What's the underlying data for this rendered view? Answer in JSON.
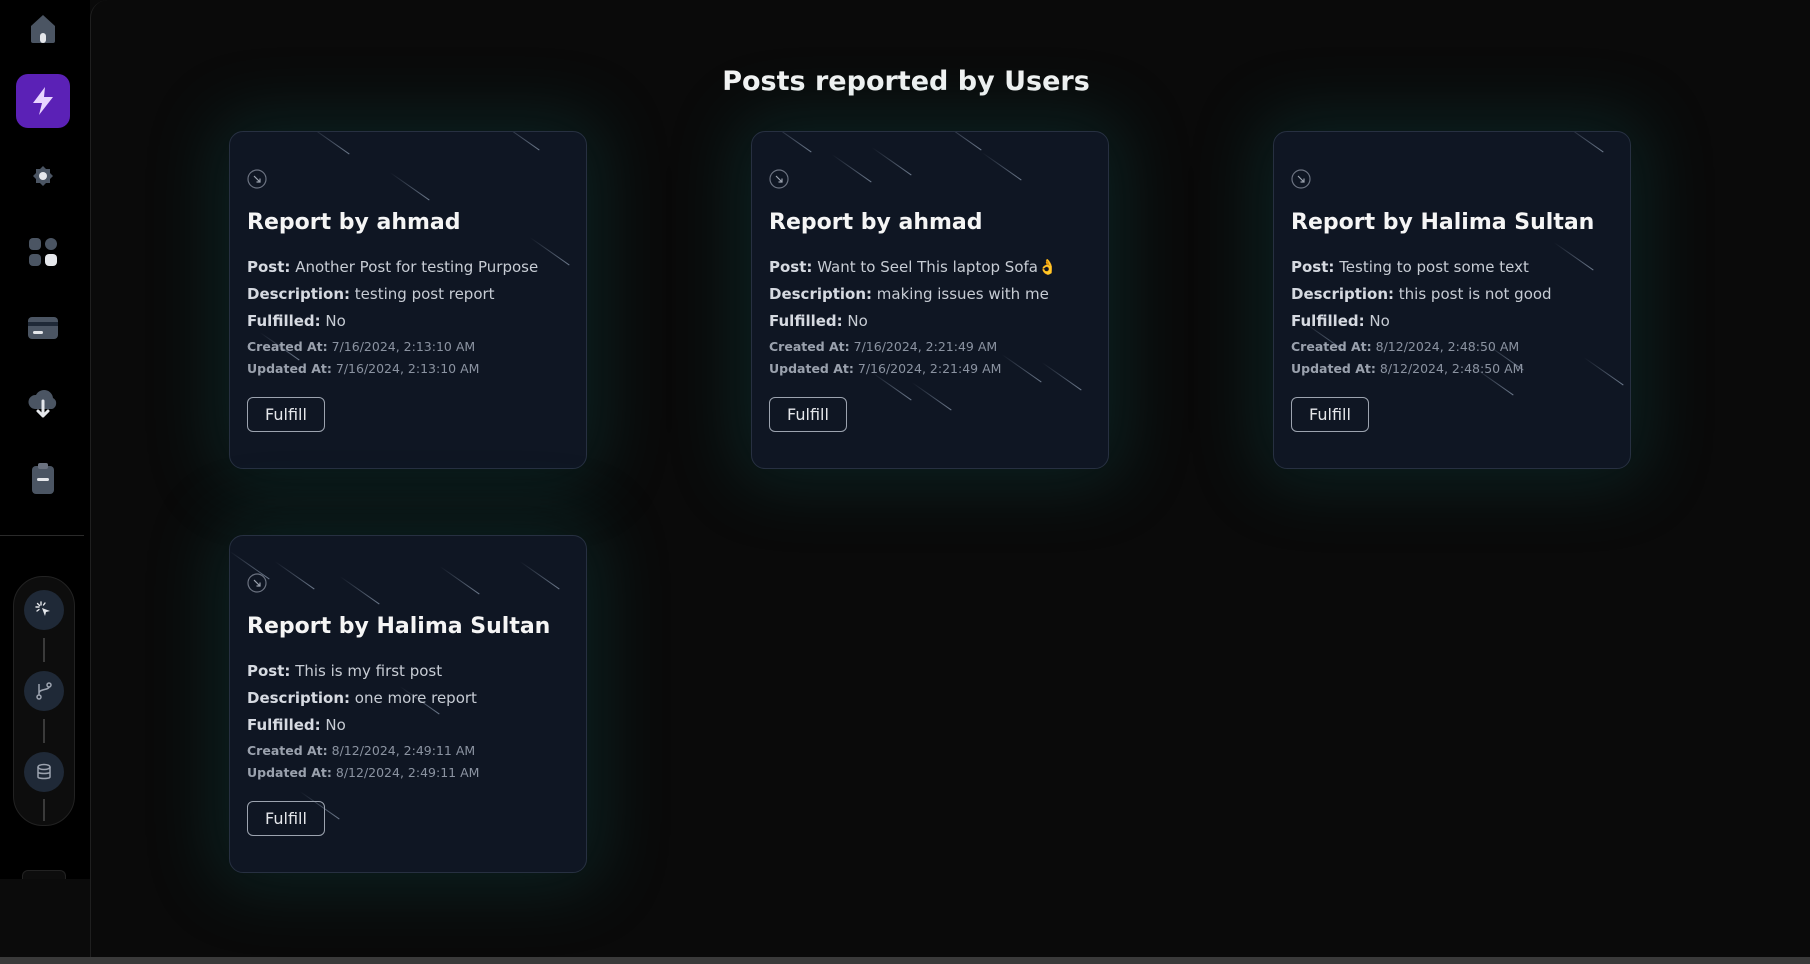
{
  "sidebar": {
    "nav_items": [
      {
        "icon": "home-icon"
      },
      {
        "icon": "lightning-icon",
        "active": true
      },
      {
        "icon": "gear-icon"
      },
      {
        "icon": "apps-grid-icon"
      },
      {
        "icon": "credit-card-icon"
      },
      {
        "icon": "cloud-download-icon"
      },
      {
        "icon": "clipboard-icon"
      }
    ],
    "tools": [
      {
        "icon": "cursor-click-icon"
      },
      {
        "icon": "git-branch-icon"
      },
      {
        "icon": "database-icon"
      }
    ]
  },
  "page": {
    "title": "Posts reported by Users"
  },
  "labels": {
    "post": "Post:",
    "description": "Description:",
    "fulfilled": "Fulfilled:",
    "created_at": "Created At:",
    "updated_at": "Updated At:",
    "fulfill_button": "Fulfill"
  },
  "reports": [
    {
      "title": "Report by ahmad",
      "post": "Another Post for testing Purpose",
      "description": "testing post report",
      "fulfilled": "No",
      "created_at": "7/16/2024, 2:13:10 AM",
      "updated_at": "7/16/2024, 2:13:10 AM"
    },
    {
      "title": "Report by ahmad",
      "post": "Want to Seel This laptop Sofa👌",
      "description": "making issues with me",
      "fulfilled": "No",
      "created_at": "7/16/2024, 2:21:49 AM",
      "updated_at": "7/16/2024, 2:21:49 AM"
    },
    {
      "title": "Report by Halima Sultan",
      "post": "Testing to post some text",
      "description": "this post is not good",
      "fulfilled": "No",
      "created_at": "8/12/2024, 2:48:50 AM",
      "updated_at": "8/12/2024, 2:48:50 AM"
    },
    {
      "title": "Report by Halima Sultan",
      "post": "This is my first post",
      "description": "one more report",
      "fulfilled": "No",
      "created_at": "8/12/2024, 2:49:11 AM",
      "updated_at": "8/12/2024, 2:49:11 AM"
    }
  ],
  "colors": {
    "active_nav": "#5b21b6",
    "card_bg": "#0f1623",
    "glow": "#147878"
  }
}
